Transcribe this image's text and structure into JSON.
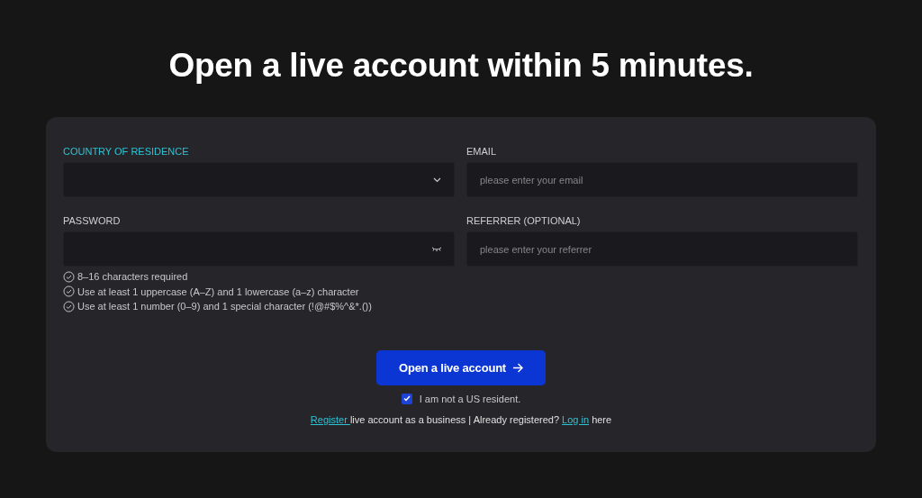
{
  "title": "Open a live account within 5 minutes.",
  "fields": [
    {
      "label": "COUNTRY OF RESIDENCE",
      "kind": "select",
      "focused": true
    },
    {
      "label": "EMAIL",
      "kind": "text",
      "focused": false,
      "placeholder": "please enter your email"
    },
    {
      "label": "PASSWORD",
      "kind": "password",
      "focused": false
    },
    {
      "label": "REFERRER (OPTIONAL)",
      "kind": "text",
      "focused": false,
      "placeholder": "please enter your referrer"
    }
  ],
  "requirements": [
    "8–16 characters required",
    "Use at least 1 uppercase (A–Z) and 1 lowercase (a–z) character",
    "Use at least 1 number (0–9) and 1 special character (!@#$%^&*.())"
  ],
  "submit": {
    "label": "Open a live account"
  },
  "us_resident": {
    "label": "I am not a US resident.",
    "checked": true
  },
  "footer": [
    {
      "kind": "link",
      "text": "Register "
    },
    {
      "kind": "text",
      "text": "live account as a business | Already registered? "
    },
    {
      "kind": "link",
      "text": "Log in"
    },
    {
      "kind": "text",
      "text": " here"
    }
  ]
}
